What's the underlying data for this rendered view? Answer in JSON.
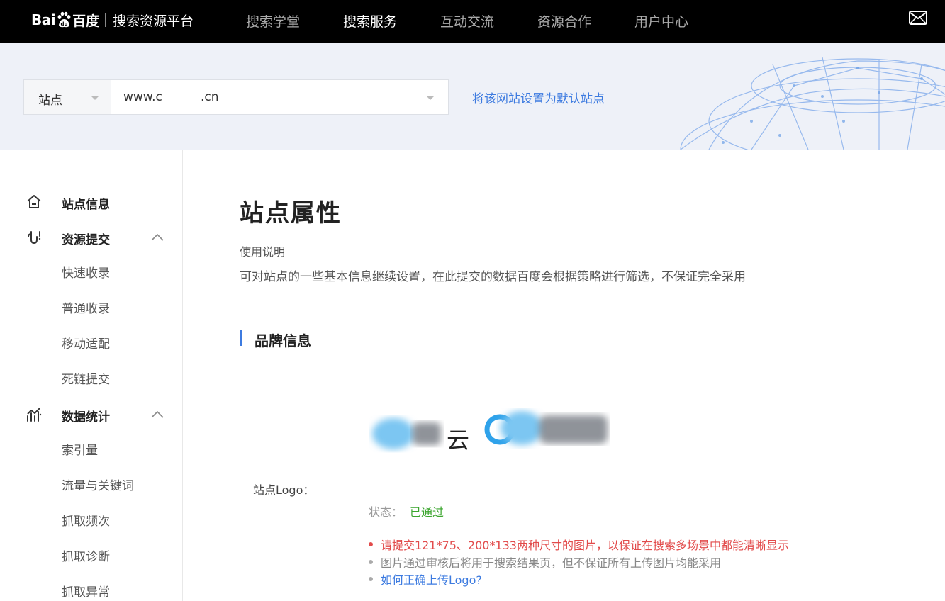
{
  "brand": {
    "logo_text_left": "Bai",
    "logo_text_right": "百度",
    "platform_name": "搜索资源平台"
  },
  "nav": {
    "items": [
      {
        "label": "搜索学堂",
        "active": false
      },
      {
        "label": "搜索服务",
        "active": true
      },
      {
        "label": "互动交流",
        "active": false
      },
      {
        "label": "资源合作",
        "active": false
      },
      {
        "label": "用户中心",
        "active": false
      }
    ],
    "mail_icon": "mail-icon"
  },
  "site_bar": {
    "type_select": "站点",
    "site_value": "www.c          .cn",
    "default_link": "将该网站设置为默认站点"
  },
  "sidebar": {
    "site_info": {
      "label": "站点信息",
      "icon": "home-icon"
    },
    "resource_submit": {
      "label": "资源提交",
      "icon": "submit-hook-icon",
      "items": [
        "快速收录",
        "普通收录",
        "移动适配",
        "死链提交"
      ]
    },
    "data_stats": {
      "label": "数据统计",
      "icon": "stats-chart-icon",
      "items": [
        "索引量",
        "流量与关键词",
        "抓取频次",
        "抓取诊断",
        "抓取异常"
      ]
    }
  },
  "main": {
    "title": "站点属性",
    "usage_label": "使用说明",
    "usage_text": "可对站点的一些基本信息继续设置，在此提交的数据百度会根据策略进行筛选，不保证完全采用",
    "section_title": "品牌信息",
    "logo_field_label": "站点Logo：",
    "logo_img1_char": "云",
    "status_label": "状态：",
    "status_value": "已通过",
    "notes": {
      "red": "请提交121*75、200*133两种尺寸的图片，以保证在搜索多场景中都能清晰显示",
      "gray": "图片通过审核后将用于搜索结果页，但不保证所有上传图片均能采用",
      "link": "如何正确上传Logo?"
    }
  },
  "colors": {
    "nav_bg": "#000000",
    "banner_bg": "#eef1f8",
    "accent_blue": "#3d7be0",
    "status_green": "#3aa52d",
    "note_red": "#e24b4b"
  }
}
